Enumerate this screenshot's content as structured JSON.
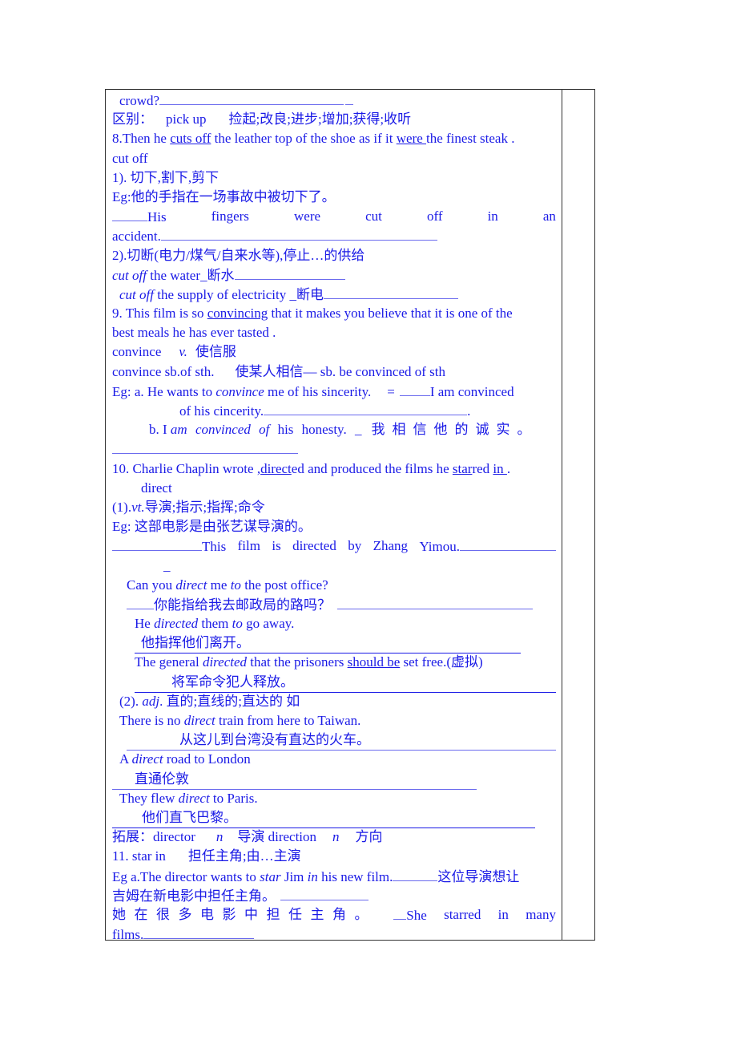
{
  "doc": {
    "lines": {
      "l1": "crowd?",
      "l2a": "区别：",
      "l2b": "pick up",
      "l2c": "捡起;改良;进步;增加;获得;收听",
      "l3a": "8.Then he ",
      "l3b": "cuts off",
      "l3c": " the leather top of the shoe as if it ",
      "l3d": "were ",
      "l3e": "the finest steak .",
      "l4": "cut off",
      "l5": "1).  切下,割下,剪下",
      "l6": "Eg:他的手指在一场事故中被切下了。",
      "l7": [
        "His",
        "fingers",
        "were",
        "cut",
        "off",
        "in",
        "an"
      ],
      "l8": "accident.",
      "l9": "2).切断(电力/煤气/自来水等),停止…的供给",
      "l10a": "cut off",
      "l10b": " the water_断水",
      "l11a": "cut off",
      "l11b": " the supply of electricity _断电",
      "l12a": "9. This film is so ",
      "l12b": "convincing",
      "l12c": " that it makes you believe that it is one of the",
      "l13": "best meals he has ever tasted .",
      "l14a": "convince",
      "l14b": "v.",
      "l14c": "使信服",
      "l15a": "convince sb.of sth.",
      "l15b": "使某人相信— sb. be convinced of sth",
      "l16a": "Eg: a. He wants to ",
      "l16b": "convince",
      "l16c": " me of his sincerity.",
      "l16d": "=",
      "l16e": "I am convinced",
      "l17": "of his cincerity.",
      "l17b": ".",
      "l18a": "b. I ",
      "l18b": "am convinced of",
      "l18c": " his honesty. _",
      "l18d": "我相信他的诚实。",
      "l19a": "10. Charlie Chaplin wrote ,",
      "l19b": "direct",
      "l19c": "ed and produced the films he ",
      "l19d": "star",
      "l19e": "red ",
      "l19f": "in ",
      "l19g": ".",
      "l20": "direct",
      "l21a": "(1).",
      "l21b": "vt.",
      "l21c": "导演;指示;指挥;命令",
      "l22": "Eg:  这部电影是由张艺谋导演的。",
      "l23": [
        "This",
        "film",
        "is",
        "directed",
        "by",
        "Zhang",
        "Yimou."
      ],
      "l24": "_",
      "l25a": "Can you ",
      "l25b": "direct",
      "l25c": " me ",
      "l25d": "to",
      "l25e": " the post office?",
      "l26": "你能指给我去邮政局的路吗？",
      "l27a": "He ",
      "l27b": "directed",
      "l27c": " them ",
      "l27d": "to",
      "l27e": " go away.",
      "l28": "他指挥他们离开。",
      "l29a": "The general ",
      "l29b": "directed",
      "l29c": " that the prisoners ",
      "l29d": "should be",
      "l29e": " set free.(虚拟)",
      "l30": "将军命令犯人释放。",
      "l31a": "(2). ",
      "l31b": "adj",
      "l31c": ".  直的;直线的;直达的  如",
      "l32a": "There is no ",
      "l32b": "direct",
      "l32c": " train from here to Taiwan.",
      "l33": "从这儿到台湾没有直达的火车。",
      "l34a": "A ",
      "l34b": "direct",
      "l34c": " road to London",
      "l35": "直通伦敦",
      "l36a": "They flew ",
      "l36b": "direct",
      "l36c": " to Paris.",
      "l37": "他们直飞巴黎。",
      "l38a": "拓展：director",
      "l38b": "n",
      "l38c": "导演 direction",
      "l38d": "n",
      "l38e": "方向",
      "l39a": "11. star in",
      "l39b": "担任主角;由…主演",
      "l40a": "Eg a.The director wants to ",
      "l40b": "star",
      "l40c": " Jim ",
      "l40d": "in",
      "l40e": " his new film.",
      "l40f": "这位导演想让",
      "l41": "吉姆在新电影中担任主角。",
      "l42": [
        "她在很多电影中担任主角。",
        "She",
        "starred",
        "in",
        "many"
      ],
      "l43": "films."
    }
  }
}
